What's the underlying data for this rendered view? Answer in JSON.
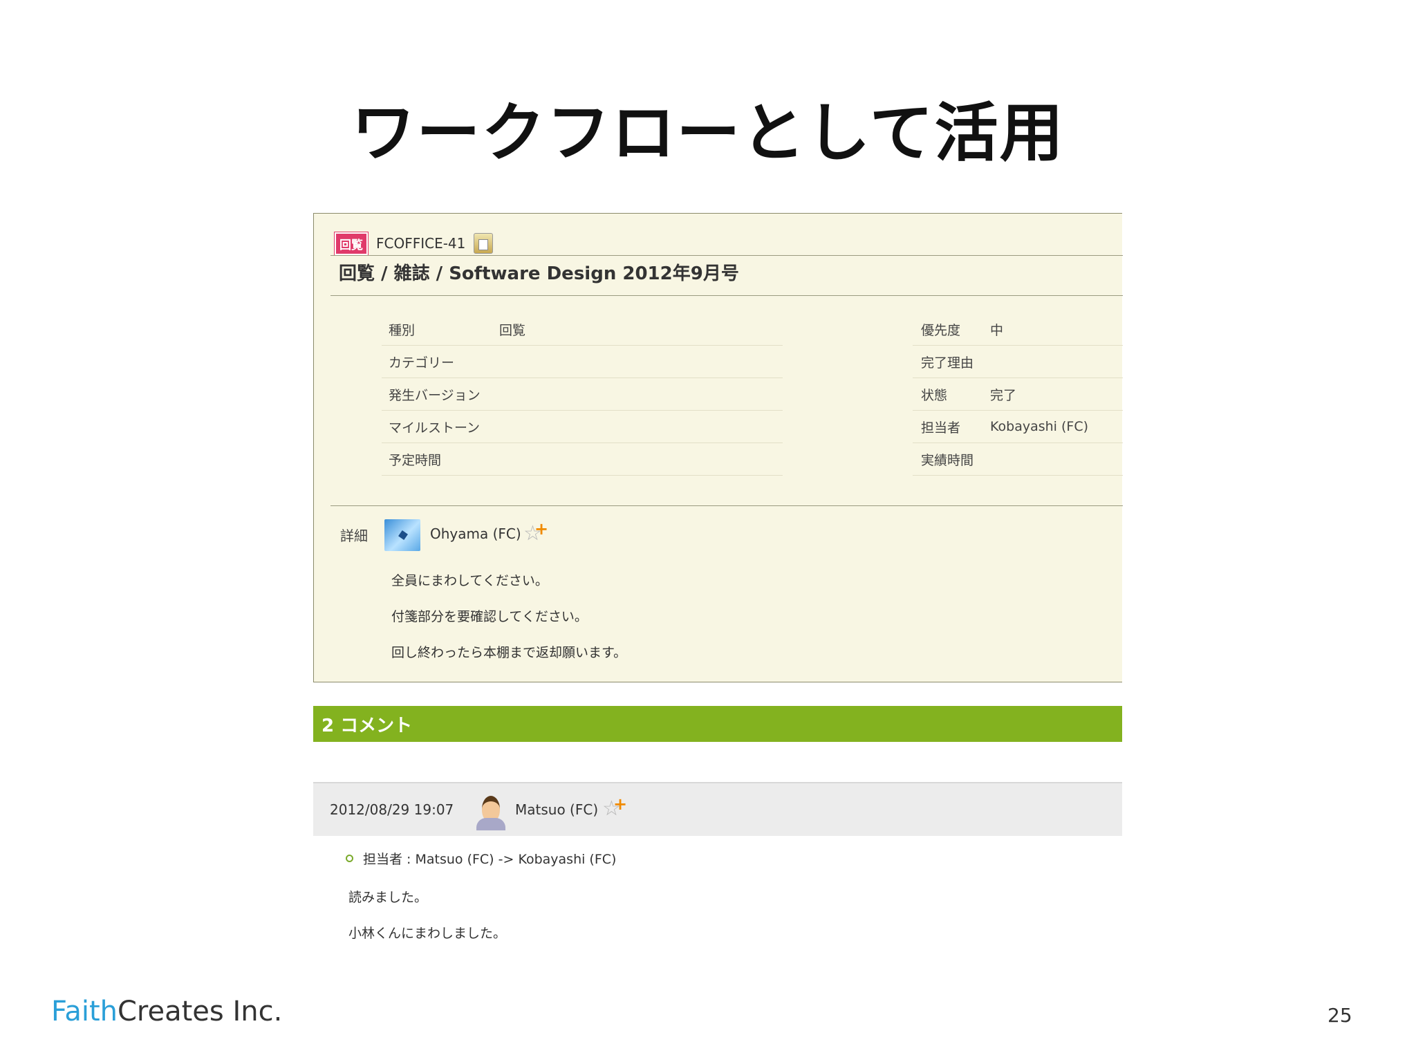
{
  "slide": {
    "title": "ワークフローとして活用",
    "page_number": "25",
    "footer_brand_part1": "Faith",
    "footer_brand_part2": "Creates Inc."
  },
  "ticket": {
    "type_badge": "回覧",
    "key": "FCOFFICE-41",
    "title": "回覧 / 雑誌 / Software Design 2012年9月号",
    "left_fields": [
      {
        "label": "種別",
        "value": "回覧"
      },
      {
        "label": "カテゴリー",
        "value": ""
      },
      {
        "label": "発生バージョン",
        "value": ""
      },
      {
        "label": "マイルストーン",
        "value": ""
      },
      {
        "label": "予定時間",
        "value": ""
      }
    ],
    "right_fields": [
      {
        "label": "優先度",
        "value": "中"
      },
      {
        "label": "完了理由",
        "value": ""
      },
      {
        "label": "状態",
        "value": "完了"
      },
      {
        "label": "担当者",
        "value": "Kobayashi (FC)"
      },
      {
        "label": "実績時間",
        "value": ""
      }
    ],
    "detail_label": "詳細",
    "author": "Ohyama (FC)",
    "detail_lines": [
      "全員にまわしてください。",
      "付箋部分を要確認してください。",
      "回し終わったら本棚まで返却願います。"
    ]
  },
  "comments": {
    "header": "2 コメント",
    "items": [
      {
        "date": "2012/08/29 19:07",
        "author": "Matsuo (FC)",
        "change": "担当者 : Matsuo (FC) -> Kobayashi (FC)",
        "lines": [
          "読みました。",
          "小林くんにまわしました。"
        ]
      }
    ]
  },
  "colors": {
    "comments_bar": "#83b21f",
    "badge": "#e03a6a",
    "panel_bg": "#f8f6e3",
    "brand_accent": "#2a9fd8"
  }
}
